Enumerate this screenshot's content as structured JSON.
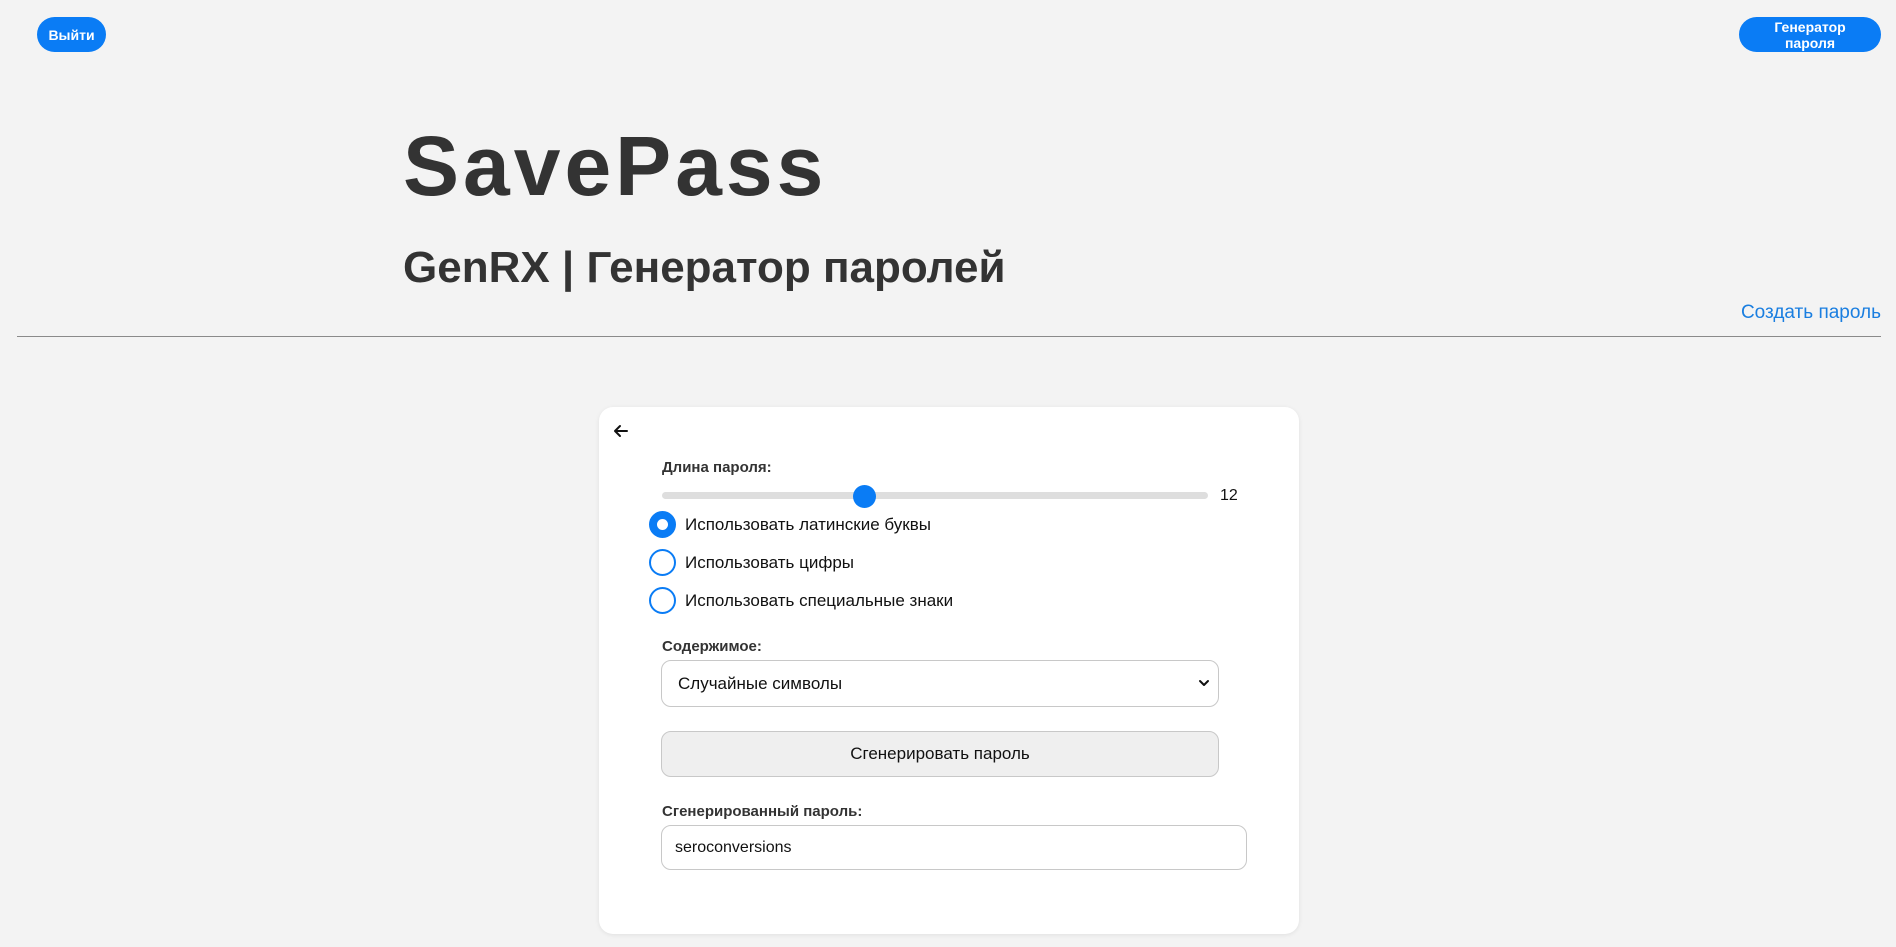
{
  "header": {
    "logout_label": "Выйти",
    "generator_label": "Генератор пароля",
    "brand": "SavePass",
    "subtitle": "GenRX | Генератор паролей",
    "create_link": "Создать пароль"
  },
  "form": {
    "back_icon": "arrow-left-icon",
    "length_label": "Длина пароля:",
    "length_value": "12",
    "length_fraction": 0.37,
    "options": [
      {
        "label": "Использовать латинские буквы",
        "checked": true
      },
      {
        "label": "Использовать цифры",
        "checked": false
      },
      {
        "label": "Использовать специальные знаки",
        "checked": false
      }
    ],
    "content_label": "Содержимое:",
    "content_selected": "Случайные символы",
    "generate_label": "Сгенерировать пароль",
    "output_label": "Сгенерированный пароль:",
    "output_value": "seroconversions"
  },
  "colors": {
    "accent": "#0a7cf5",
    "background": "#f3f3f3",
    "link": "#1a7ee0"
  }
}
